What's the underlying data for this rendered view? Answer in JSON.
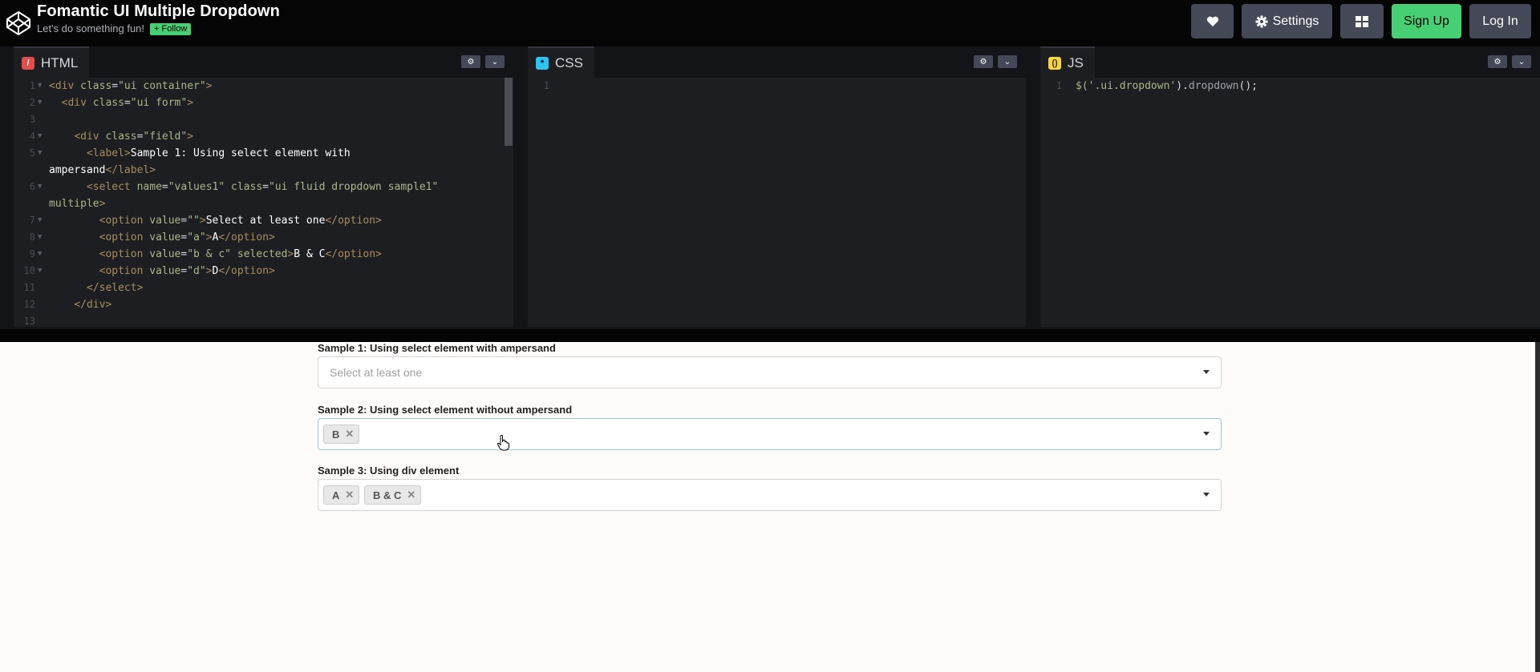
{
  "header": {
    "title": "Fomantic UI Multiple Dropdown",
    "subtitle": "Let's do something fun!",
    "follow_label": "+ Follow",
    "heart_icon": "heart-icon",
    "settings_label": "Settings",
    "signup_label": "Sign Up",
    "login_label": "Log In"
  },
  "editors": {
    "html": {
      "label": "HTML",
      "lines": [
        {
          "n": "1",
          "fold": true
        },
        {
          "n": "2",
          "fold": true
        },
        {
          "n": "3",
          "fold": false
        },
        {
          "n": "4",
          "fold": true
        },
        {
          "n": "5",
          "fold": true
        },
        {
          "n": "",
          "fold": false
        },
        {
          "n": "6",
          "fold": true
        },
        {
          "n": "",
          "fold": false
        },
        {
          "n": "7",
          "fold": true
        },
        {
          "n": "8",
          "fold": true
        },
        {
          "n": "9",
          "fold": true
        },
        {
          "n": "10",
          "fold": true
        },
        {
          "n": "11",
          "fold": false
        },
        {
          "n": "12",
          "fold": false
        },
        {
          "n": "13",
          "fold": false
        }
      ]
    },
    "css": {
      "label": "CSS",
      "line_number": "1"
    },
    "js": {
      "label": "JS",
      "line_number": "1",
      "code_dollar": "$(",
      "code_str": "'.ui.dropdown'",
      "code_close": ").",
      "code_fn": "dropdown",
      "code_end": "();"
    }
  },
  "preview": {
    "sample1": {
      "label": "Sample 1: Using select element with ampersand",
      "placeholder": "Select at least one"
    },
    "sample2": {
      "label": "Sample 2: Using select element without ampersand",
      "chips": [
        "B"
      ]
    },
    "sample3": {
      "label": "Sample 3: Using div element",
      "chips": [
        "A",
        "B & C"
      ]
    }
  }
}
